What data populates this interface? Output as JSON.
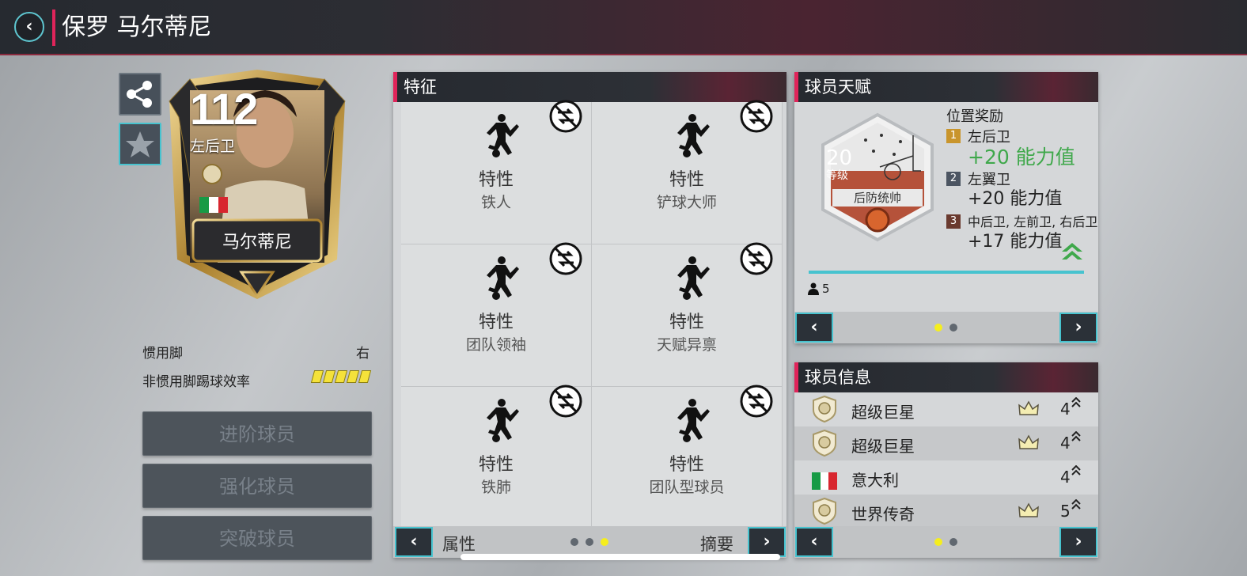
{
  "header": {
    "title": "保罗 马尔蒂尼"
  },
  "card": {
    "rating": "112",
    "position": "左后卫",
    "name": "马尔蒂尼",
    "nation_flag": "Italy"
  },
  "player_stats": {
    "preferred_foot_label": "惯用脚",
    "preferred_foot_value": "右",
    "weak_foot_label": "非惯用脚踢球效率",
    "weak_foot_level": 5
  },
  "actions": [
    {
      "label": "进阶球员"
    },
    {
      "label": "强化球员"
    },
    {
      "label": "突破球员"
    }
  ],
  "traits_panel": {
    "title": "特征",
    "items": [
      {
        "type": "特性",
        "name": "铁人"
      },
      {
        "type": "特性",
        "name": "铲球大师"
      },
      {
        "type": "特性",
        "name": "团队领袖"
      },
      {
        "type": "特性",
        "name": "天赋异禀"
      },
      {
        "type": "特性",
        "name": "铁肺"
      },
      {
        "type": "特性",
        "name": "团队型球员"
      }
    ],
    "footer_left": "属性",
    "footer_right": "摘要",
    "page_count": 3,
    "active_page": 3
  },
  "talent_panel": {
    "title": "球员天赋",
    "level_number": "20",
    "level_unit": "等级",
    "talent_name": "后防统帅",
    "bonus_title": "位置奖励",
    "bonuses": [
      {
        "rank": "1",
        "positions": "左后卫",
        "value": "+20 能力值",
        "rank_color": "#c9952c",
        "value_color": "#3fa84b"
      },
      {
        "rank": "2",
        "positions": "左翼卫",
        "value": "+20 能力值",
        "rank_color": "#4c5562",
        "value_color": "#222222"
      },
      {
        "rank": "3",
        "positions": "中后卫, 左前卫, 右后卫",
        "value": "+17 能力值",
        "rank_color": "#6a3a2f",
        "value_color": "#222222"
      }
    ],
    "count": "5",
    "page_count": 2,
    "active_page": 1
  },
  "info_panel": {
    "title": "球员信息",
    "rows": [
      {
        "label": "超级巨星",
        "value": "4",
        "icon": "icon-badge-icon",
        "crown": true
      },
      {
        "label": "超级巨星",
        "value": "4",
        "icon": "icon-badge-icon",
        "crown": true
      },
      {
        "label": "意大利",
        "value": "4",
        "icon": "italy-flag-icon",
        "crown": false
      },
      {
        "label": "世界传奇",
        "value": "5",
        "icon": "icon-badge-icon",
        "crown": true
      }
    ],
    "page_count": 2,
    "active_page": 1
  },
  "colors": {
    "accent": "#e0245a",
    "teal": "#47c3cf",
    "highlight_yellow": "#f5ee1e",
    "green": "#3fa84b"
  }
}
